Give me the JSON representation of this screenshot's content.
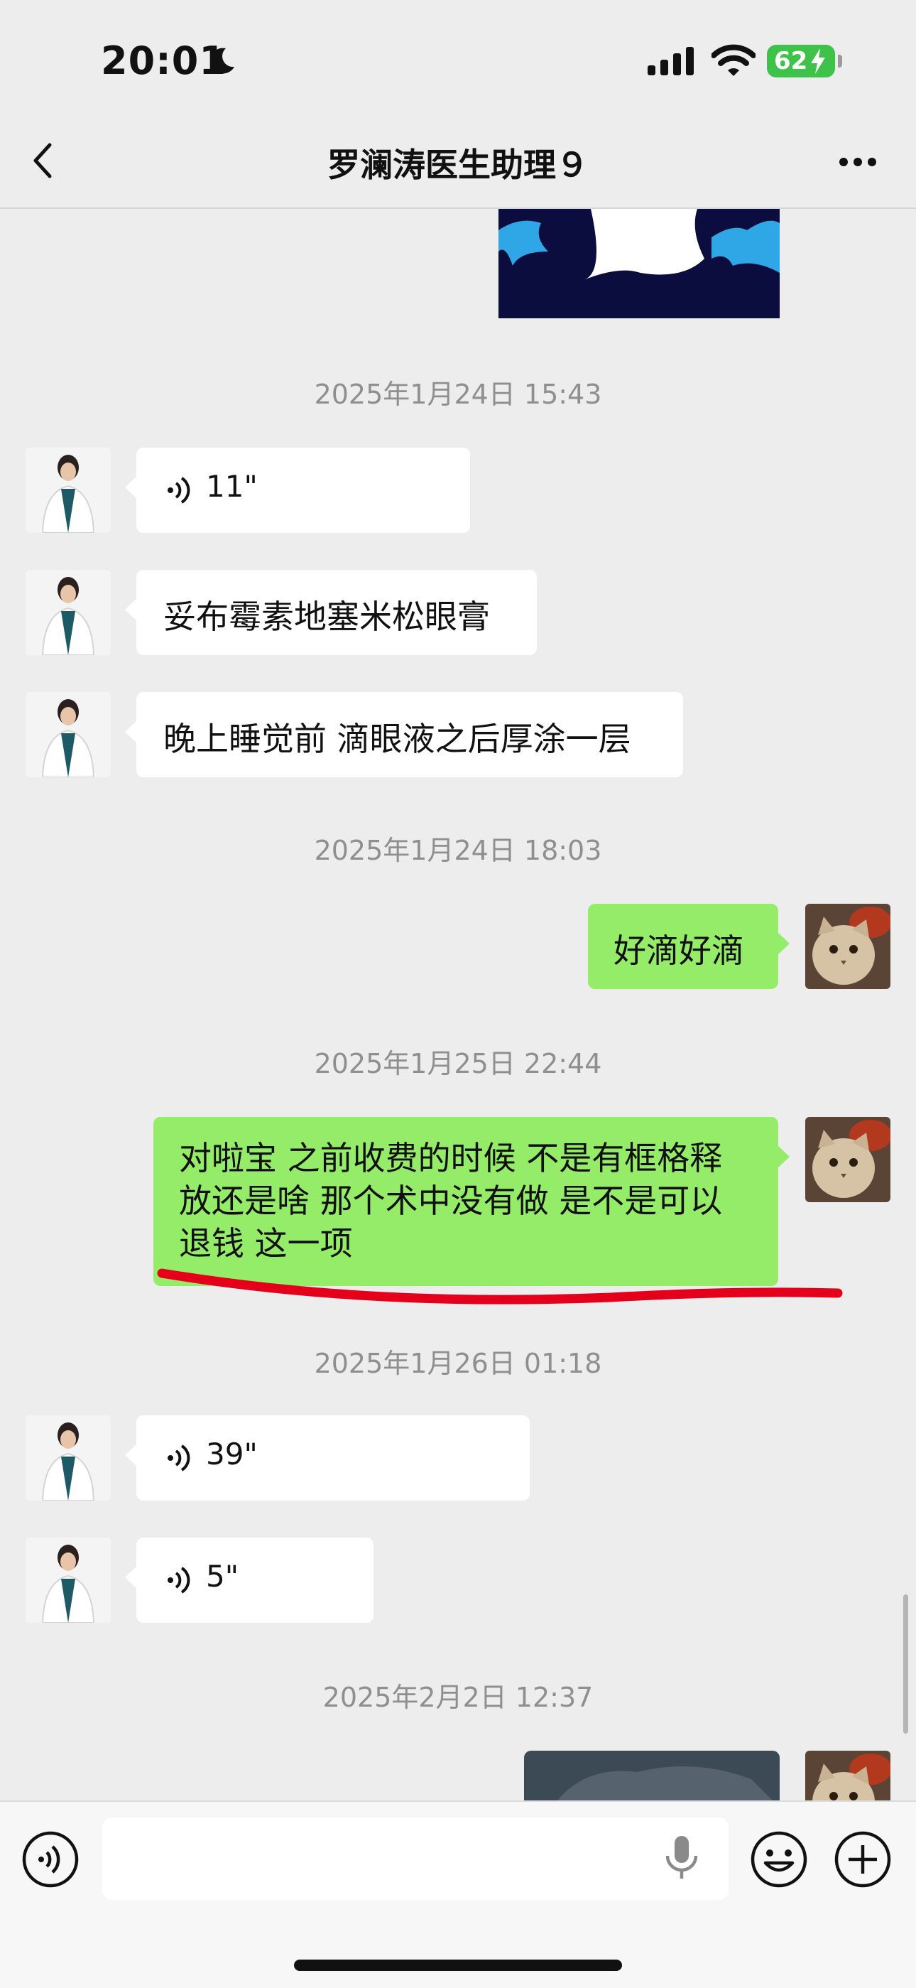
{
  "status_bar": {
    "time": "20:01",
    "battery_percent": "62",
    "icons": [
      "moon-icon",
      "cellular-signal-icon",
      "wifi-icon",
      "battery-charging-icon"
    ]
  },
  "header": {
    "title": "罗澜涛医生助理９",
    "back_icon": "chevron-left-icon",
    "more_icon": "ellipsis-icon"
  },
  "messages": {
    "ts1": "2025年1月24日 15:43",
    "voice1": "11\"",
    "text1": "妥布霉素地塞米松眼膏",
    "text2": "晚上睡觉前 滴眼液之后厚涂一层",
    "ts2": "2025年1月24日 18:03",
    "text3": "好滴好滴",
    "ts3": "2025年1月25日 22:44",
    "text4_line1": "对啦宝 之前收费的时候 不是有框格释",
    "text4_line2": "放还是啥 那个术中没有做 是不是可以",
    "text4_line3": "退钱 这一项",
    "ts4": "2025年1月26日 01:18",
    "voice2": "39\"",
    "voice3": "5\"",
    "ts5": "2025年2月2日 12:37"
  },
  "input_bar": {
    "placeholder": "",
    "icons": [
      "voice-toggle-icon",
      "microphone-icon",
      "emoji-icon",
      "plus-icon"
    ]
  },
  "colors": {
    "background": "#ededed",
    "incoming_bubble": "#ffffff",
    "outgoing_bubble": "#95ec69",
    "annotation_red": "#e4001b",
    "battery_green": "#3ec24a"
  }
}
